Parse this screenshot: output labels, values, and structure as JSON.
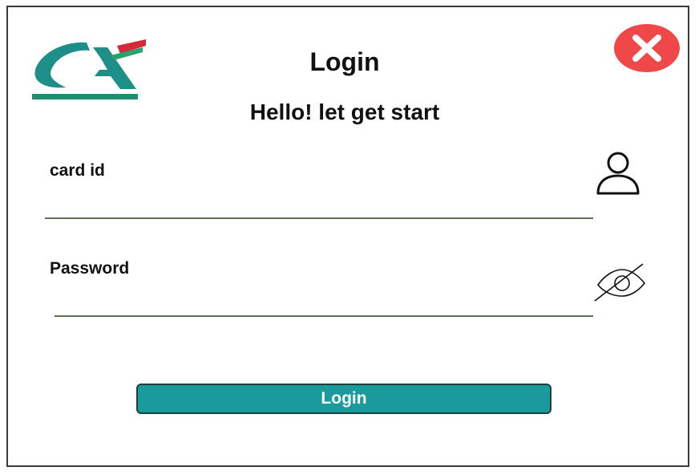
{
  "window": {
    "title": "Login",
    "subtitle": "Hello! let get start"
  },
  "logo": {
    "name": "ca-logo",
    "text": "CA",
    "colors": {
      "teal": "#1a8f86",
      "green": "#1d9a6c",
      "red": "#d42a3a"
    }
  },
  "close_button": {
    "icon": "close-icon",
    "color": "#f04848"
  },
  "fields": {
    "card_id": {
      "label": "card id",
      "value": "",
      "icon": "user-icon"
    },
    "password": {
      "label": "Password",
      "value": "",
      "icon": "eye-off-icon"
    }
  },
  "actions": {
    "login_label": "Login",
    "login_color": "#1a9a9a"
  }
}
